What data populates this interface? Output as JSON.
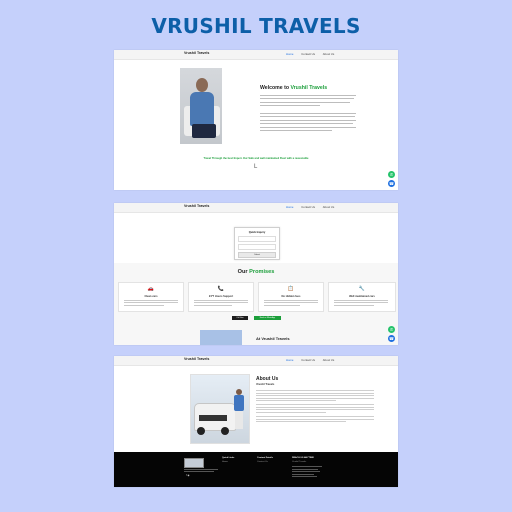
{
  "brand": {
    "title": "VRUSHIL TRAVELS"
  },
  "shot1": {
    "nav": {
      "logo": "Vrushil Travels",
      "links": [
        "Home",
        "Contact Us",
        "About Us"
      ]
    },
    "welcome_prefix": "Welcome to ",
    "welcome_highlight": "Vrushil Travels",
    "tagline": "Travel Through the best Experi. Our Safe and well maintained Fleet with a reasonable",
    "scroll_glyph": "L",
    "fab_whatsapp_glyph": "✆",
    "fab_call_glyph": "☎"
  },
  "shot2": {
    "nav": {
      "logo": "Vrushil Travels",
      "links": [
        "Home",
        "Contact Us",
        "About Us"
      ]
    },
    "login": {
      "title": "Quick Inquiry",
      "btn": "Submit"
    },
    "promise_prefix": "Our ",
    "promise_highlight": "Promises",
    "cards": [
      {
        "icon": "🚗",
        "title": "Clean cars",
        "color": "#d23a3a"
      },
      {
        "icon": "📞",
        "title": "24*7 Hours Support",
        "color": "#d23a3a"
      },
      {
        "icon": "📋",
        "title": "No Hidden fees",
        "color": "#d2a03a"
      },
      {
        "icon": "🔧",
        "title": "Well maintained cars",
        "color": "#777777"
      }
    ],
    "btn_dark": "Call Now",
    "btn_green": "Book on WhatsApp",
    "about_heading": "At Vrushil Travels",
    "fab_whatsapp_glyph": "✆",
    "fab_call_glyph": "☎"
  },
  "shot3": {
    "nav": {
      "logo": "Vrushil Travels",
      "links": [
        "Home",
        "Contact Us",
        "About Us"
      ]
    },
    "about_title": "About Us",
    "about_sub": "Vrushil Travels",
    "footer": {
      "cols": [
        {
          "title": "Quick Links",
          "sub": "Home"
        },
        {
          "title": "Contact Details",
          "sub": "Contact Us"
        },
        {
          "title": "REACH US ANYTIME",
          "sub": "Vrushil Travels"
        }
      ],
      "social": "f ◉"
    }
  }
}
